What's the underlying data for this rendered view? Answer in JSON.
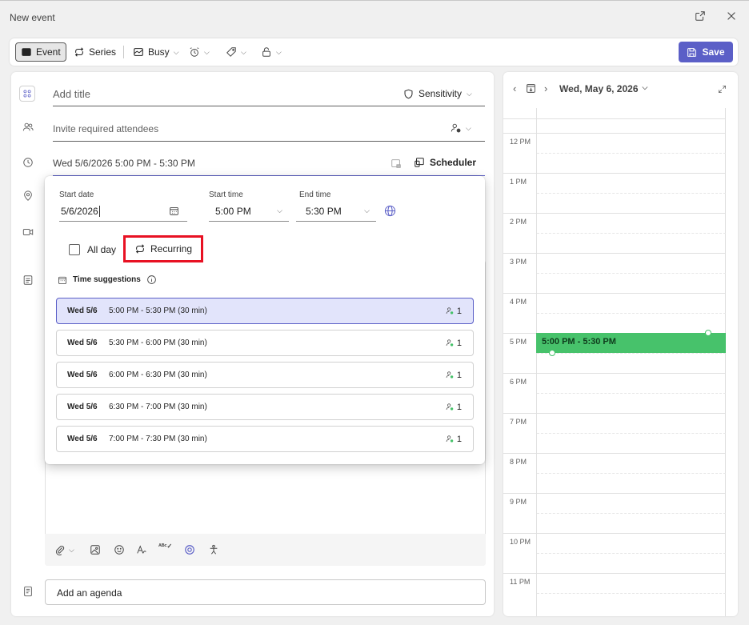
{
  "window": {
    "title": "New event"
  },
  "toolbar": {
    "event_label": "Event",
    "series_label": "Series",
    "busy_label": "Busy",
    "save_label": "Save"
  },
  "form": {
    "title_placeholder": "Add title",
    "sensitivity_label": "Sensitivity",
    "attendees_placeholder": "Invite required attendees",
    "datetime_value": "Wed 5/6/2026 5:00 PM - 5:30 PM",
    "scheduler_label": "Scheduler",
    "agenda_placeholder": "Add an agenda"
  },
  "popup": {
    "start_date_label": "Start date",
    "start_date_value": "5/6/2026",
    "start_time_label": "Start time",
    "start_time_value": "5:00 PM",
    "end_time_label": "End time",
    "end_time_value": "5:30 PM",
    "all_day_label": "All day",
    "recurring_label": "Recurring",
    "suggestions_title": "Time suggestions",
    "suggestions": [
      {
        "date": "Wed 5/6",
        "time": "5:00 PM - 5:30 PM (30 min)",
        "count": "1",
        "selected": true
      },
      {
        "date": "Wed 5/6",
        "time": "5:30 PM - 6:00 PM (30 min)",
        "count": "1",
        "selected": false
      },
      {
        "date": "Wed 5/6",
        "time": "6:00 PM - 6:30 PM (30 min)",
        "count": "1",
        "selected": false
      },
      {
        "date": "Wed 5/6",
        "time": "6:30 PM - 7:00 PM (30 min)",
        "count": "1",
        "selected": false
      },
      {
        "date": "Wed 5/6",
        "time": "7:00 PM - 7:30 PM (30 min)",
        "count": "1",
        "selected": false
      }
    ]
  },
  "calendar": {
    "date_label": "Wed, May 6, 2026",
    "hours": [
      "12 PM",
      "1 PM",
      "2 PM",
      "3 PM",
      "4 PM",
      "5 PM",
      "6 PM",
      "7 PM",
      "8 PM",
      "9 PM",
      "10 PM",
      "11 PM"
    ],
    "event_label": "5:00 PM - 5:30 PM"
  },
  "colors": {
    "accent": "#5b5fc7",
    "event_green": "#47c26b",
    "highlight_red": "#e81123"
  }
}
